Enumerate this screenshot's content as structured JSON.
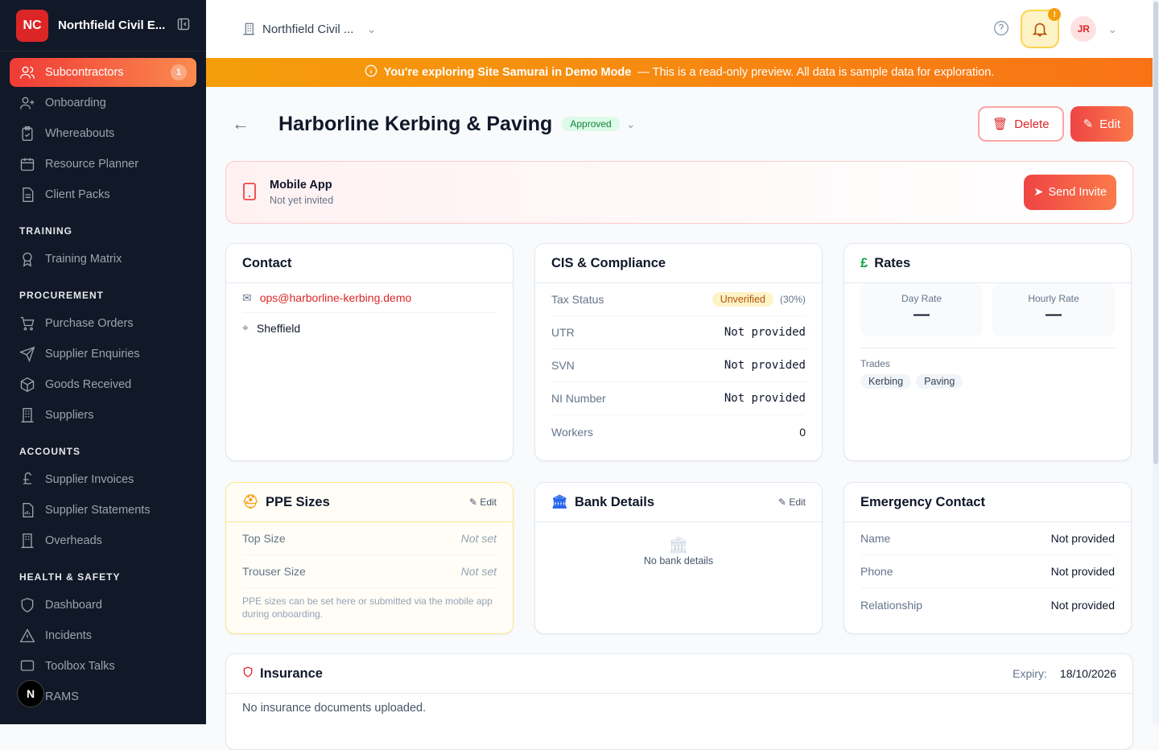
{
  "sidebar": {
    "logo": "NC",
    "org_name": "Northfield Civil E...",
    "items": [
      {
        "label": "Subcontractors",
        "badge": "1"
      },
      {
        "label": "Onboarding"
      },
      {
        "label": "Whereabouts"
      },
      {
        "label": "Resource Planner"
      },
      {
        "label": "Client Packs"
      }
    ],
    "sections": [
      {
        "title": "TRAINING",
        "items": [
          "Training Matrix"
        ]
      },
      {
        "title": "PROCUREMENT",
        "items": [
          "Purchase Orders",
          "Supplier Enquiries",
          "Goods Received",
          "Suppliers"
        ]
      },
      {
        "title": "ACCOUNTS",
        "items": [
          "Supplier Invoices",
          "Supplier Statements",
          "Overheads"
        ]
      },
      {
        "title": "HEALTH & SAFETY",
        "items": [
          "Dashboard",
          "Incidents",
          "Toolbox Talks",
          "RAMS"
        ]
      }
    ],
    "fab": "N"
  },
  "topbar": {
    "org": "Northfield Civil ...",
    "avatar": "JR",
    "bell_badge": "!"
  },
  "banner": {
    "bold": "You're exploring Site Samurai in Demo Mode",
    "text": "— This is a read-only preview. All data is sample data for exploration."
  },
  "page": {
    "title": "Harborline Kerbing & Paving",
    "status": "Approved",
    "delete": "Delete",
    "edit": "Edit"
  },
  "mobile": {
    "title": "Mobile App",
    "subtitle": "Not yet invited",
    "send": "Send Invite"
  },
  "contact": {
    "title": "Contact",
    "email": "ops@harborline-kerbing.demo",
    "location": "Sheffield"
  },
  "cis": {
    "title": "CIS & Compliance",
    "tax_label": "Tax Status",
    "tax_status": "Unverified",
    "tax_rate": "(30%)",
    "rows": [
      {
        "label": "UTR",
        "value": "Not provided"
      },
      {
        "label": "SVN",
        "value": "Not provided"
      },
      {
        "label": "NI Number",
        "value": "Not provided"
      }
    ],
    "workers_label": "Workers",
    "workers": "0"
  },
  "rates": {
    "title": "Rates",
    "day_label": "Day Rate",
    "day": "—",
    "hourly_label": "Hourly Rate",
    "hourly": "—",
    "trades_label": "Trades",
    "trades": [
      "Kerbing",
      "Paving"
    ]
  },
  "ppe": {
    "title": "PPE Sizes",
    "edit": "Edit",
    "rows": [
      {
        "label": "Top Size",
        "value": "Not set"
      },
      {
        "label": "Trouser Size",
        "value": "Not set"
      }
    ],
    "note": "PPE sizes can be set here or submitted via the mobile app during onboarding."
  },
  "bank": {
    "title": "Bank Details",
    "edit": "Edit",
    "empty": "No bank details"
  },
  "emergency": {
    "title": "Emergency Contact",
    "rows": [
      {
        "label": "Name",
        "value": "Not provided"
      },
      {
        "label": "Phone",
        "value": "Not provided"
      },
      {
        "label": "Relationship",
        "value": "Not provided"
      }
    ]
  },
  "insurance": {
    "title": "Insurance",
    "expiry_label": "Expiry:",
    "expiry": "18/10/2026",
    "empty": "No insurance documents uploaded."
  }
}
